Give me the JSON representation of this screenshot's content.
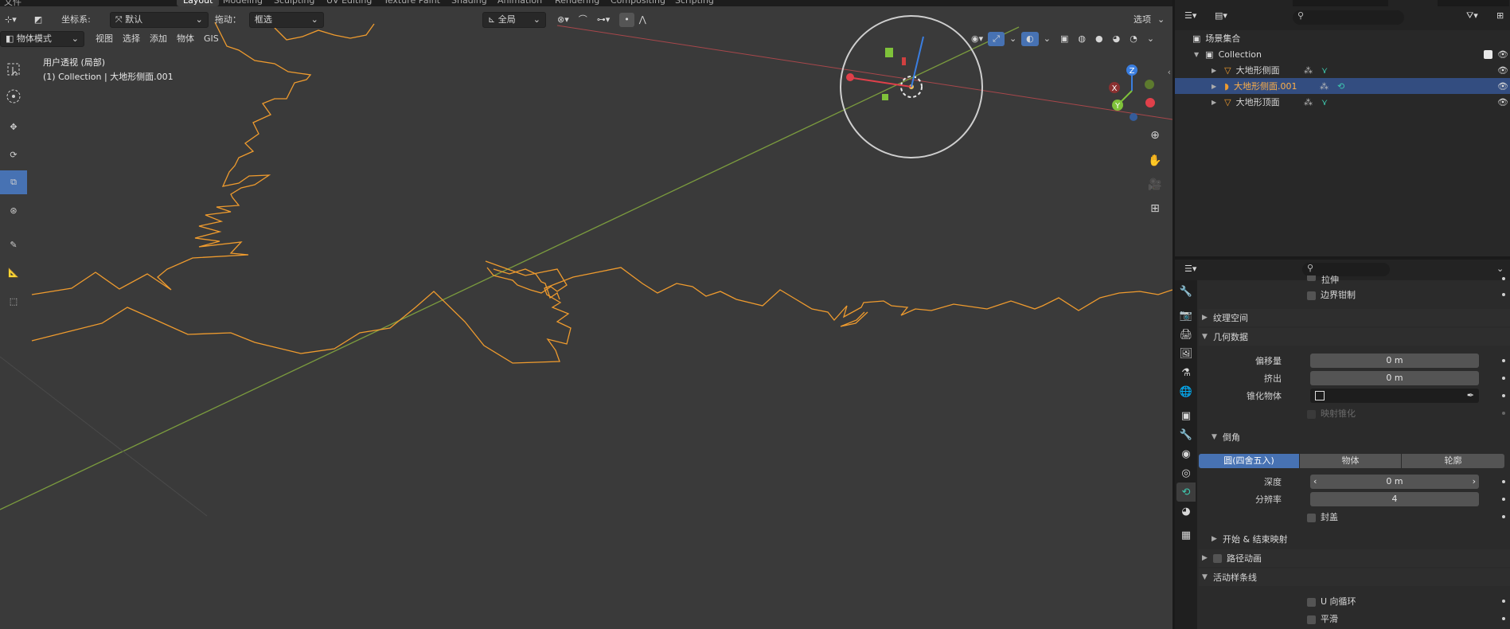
{
  "workspace_tabs": {
    "layout": "Layout",
    "modeling": "Modeling",
    "sculpting": "Sculpting",
    "uv_editing": "UV Editing",
    "texture_paint": "Texture Paint",
    "shading": "Shading",
    "animation": "Animation",
    "rendering": "Rendering",
    "compositing": "Compositing",
    "scripting": "Scripting"
  },
  "viewport": {
    "header1": {
      "coord_label": "坐标系:",
      "coord_value": "默认",
      "drag_label": "拖动：",
      "drag_value": "框选",
      "pivot_value": "全局",
      "options": "选项"
    },
    "header2": {
      "mode": "物体模式",
      "view": "视图",
      "select": "选择",
      "add": "添加",
      "object": "物体",
      "gis": "GIS"
    },
    "overlay": {
      "view_name": "用户透视 (局部)",
      "collection_info": "(1) Collection | 大地形侧面.001"
    },
    "gizmo": {
      "x": "X",
      "y": "Y",
      "z": "Z"
    }
  },
  "outliner": {
    "scene_collection": "场景集合",
    "collection": "Collection",
    "items": [
      "大地形侧面",
      "大地形侧面.001",
      "大地形顶面"
    ]
  },
  "properties": {
    "cut_top": "拉伸",
    "boundary_clamp": "边界钳制",
    "texture_space": "纹理空间",
    "geometry": "几何数据",
    "offset_label": "偏移量",
    "offset_value": "0 m",
    "extrude_label": "挤出",
    "extrude_value": "0 m",
    "taper_label": "锥化物体",
    "taper_radius": "映射锥化",
    "bevel": "倒角",
    "bevel_modes": [
      "圆(四舍五入)",
      "物体",
      "轮廓"
    ],
    "depth_label": "深度",
    "depth_value": "0 m",
    "resolution_label": "分辨率",
    "resolution_value": "4",
    "fill_caps": "封盖",
    "start_end_mapping": "开始 & 结束映射",
    "path_animation": "路径动画",
    "active_spline": "活动样条线",
    "cyclic_u": "U 向循环",
    "smooth": "平滑"
  },
  "colors": {
    "accent": "#4772b3",
    "curve": "#ef9b2e",
    "x_axis": "#c9484c",
    "y_axis": "#7fa34a",
    "selected_row": "#334d80"
  }
}
